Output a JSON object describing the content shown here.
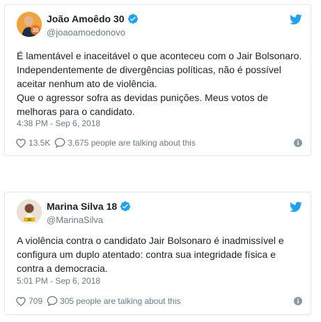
{
  "tweets": [
    {
      "name": "João Amoêdo 30",
      "handle": "@joaoamoedonovo",
      "text": [
        "É lamentável e inaceitável o que aconteceu com o Jair Bolsonaro. Independentemente de divergências políticas, não é possível aceitar nenhum ato de violência.",
        "Que o agressor sofra as devidas punições. Meus votos de melhoras para o candidato."
      ],
      "timestamp": "4:38 PM - Sep 6, 2018",
      "likes": "13.5K",
      "talking": "3,675 people are talking about this"
    },
    {
      "name": "Marina Silva 18",
      "handle": "@MarinaSilva",
      "text": [
        "A violência contra o candidato Jair Bolsonaro é inadmissível e configura um duplo atentado: contra sua integridade física e contra a democracia."
      ],
      "timestamp": "5:01 PM - Sep 6, 2018",
      "likes": "709",
      "talking": "305 people are talking about this"
    }
  ],
  "icons": {
    "verified": "verified-badge-icon",
    "bird": "twitter-bird-icon",
    "like": "heart-icon",
    "reply": "speech-bubble-icon",
    "info": "info-icon"
  },
  "colors": {
    "accent": "#1da1f2",
    "text": "#1c2022",
    "muted": "#697882",
    "border": "#e1e8ed"
  }
}
